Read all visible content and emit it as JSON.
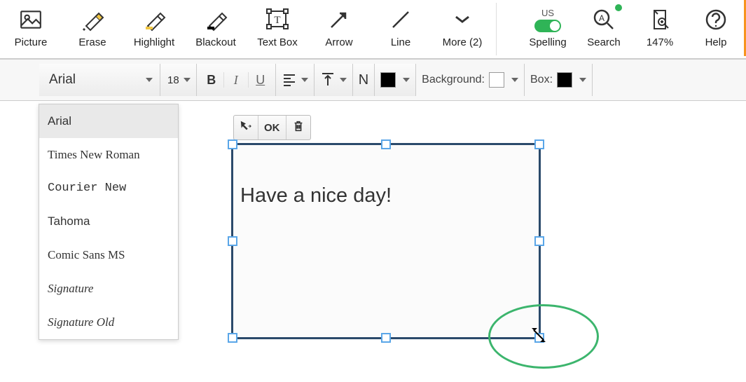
{
  "toolbar": {
    "picture": "Picture",
    "erase": "Erase",
    "highlight": "Highlight",
    "blackout": "Blackout",
    "textbox": "Text Box",
    "arrow": "Arrow",
    "line": "Line",
    "more": "More (2)",
    "spelling": "Spelling",
    "spelling_lang": "US",
    "search": "Search",
    "zoom": "147%",
    "help": "Help"
  },
  "format": {
    "font_current": "Arial",
    "font_size": "18",
    "bold": "B",
    "italic": "I",
    "underline": "U",
    "normal": "N",
    "bg_label": "Background:",
    "box_label": "Box:"
  },
  "font_options": [
    {
      "label": "Arial",
      "css": "Arial, sans-serif",
      "selected": true
    },
    {
      "label": "Times New Roman",
      "css": "'Times New Roman', serif",
      "selected": false
    },
    {
      "label": "Courier New",
      "css": "'Courier New', monospace",
      "selected": false
    },
    {
      "label": "Tahoma",
      "css": "Tahoma, sans-serif",
      "selected": false
    },
    {
      "label": "Comic Sans MS",
      "css": "'Comic Sans MS', cursive",
      "selected": false
    },
    {
      "label": "Signature",
      "css": "'Brush Script MT', cursive",
      "selected": false
    },
    {
      "label": "Signature Old",
      "css": "'Brush Script MT', cursive",
      "selected": false
    }
  ],
  "mini_toolbar": {
    "ok": "OK"
  },
  "textbox": {
    "content": "Have a nice day!"
  },
  "colors": {
    "text": "#000000",
    "background": "#ffffff",
    "box": "#000000"
  }
}
